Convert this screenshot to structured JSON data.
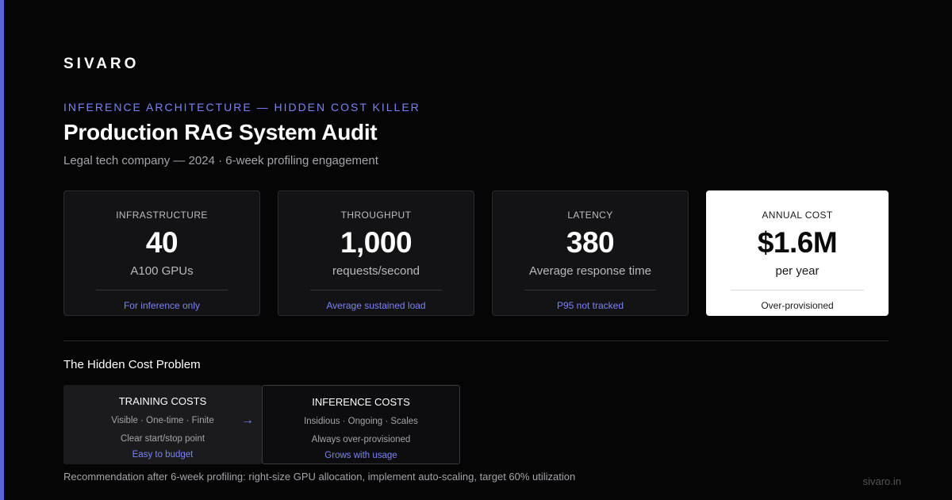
{
  "brand": "SIVARO",
  "eyebrow": "INFERENCE ARCHITECTURE — HIDDEN COST KILLER",
  "title": "Production RAG System Audit",
  "subtitle": "Legal tech company — 2024 · 6-week profiling engagement",
  "metrics": [
    {
      "label": "INFRASTRUCTURE",
      "value": "40",
      "unit": "A100 GPUs",
      "note": "For inference only"
    },
    {
      "label": "THROUGHPUT",
      "value": "1,000",
      "unit": "requests/second",
      "note": "Average sustained load"
    },
    {
      "label": "LATENCY",
      "value": "380",
      "unit": "Average response time",
      "note": "P95 not tracked"
    },
    {
      "label": "ANNUAL COST",
      "value": "$1.6M",
      "unit": "per year",
      "note": "Over-provisioned"
    }
  ],
  "section": {
    "title": "The Hidden Cost Problem",
    "training": {
      "title": "TRAINING COSTS",
      "line1": "Visible · One-time · Finite",
      "line2": "Clear start/stop point",
      "note": "Easy to budget"
    },
    "arrow": "→",
    "inference": {
      "title": "INFERENCE COSTS",
      "line1": "Insidious · Ongoing · Scales",
      "line2": "Always over-provisioned",
      "note": "Grows with usage"
    }
  },
  "recommendation": "Recommendation after 6-week profiling: right-size GPU allocation, implement auto-scaling, target 60% utilization",
  "footer_url": "sivaro.in",
  "colors": {
    "accent": "#7b83f2",
    "accent_bar": "#5b63d6",
    "background": "#050505",
    "card": "#131316",
    "highlight_card": "#ffffff"
  }
}
